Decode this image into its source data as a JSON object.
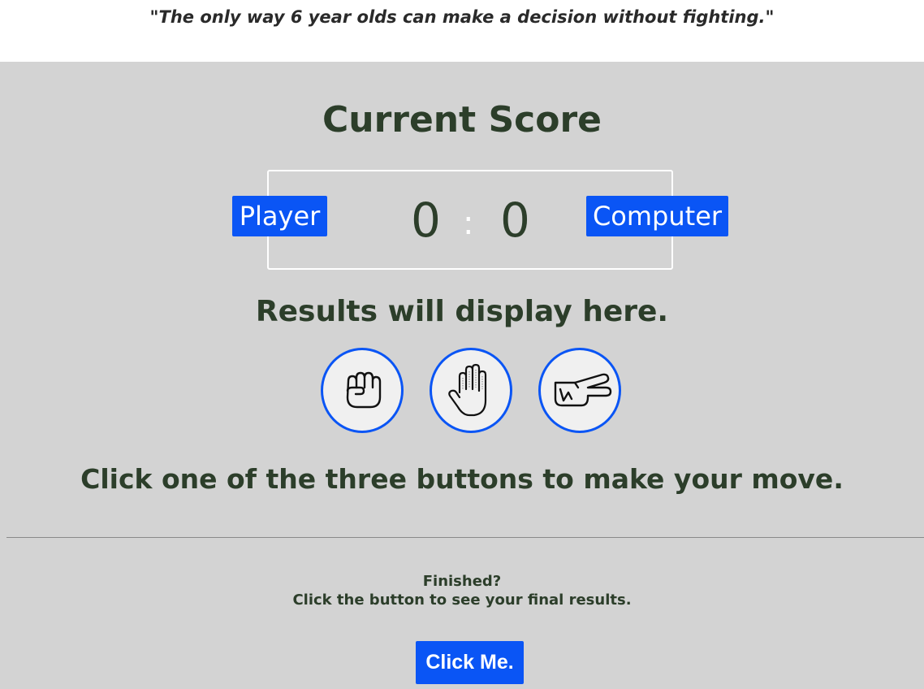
{
  "header": {
    "quote": "\"The only way 6 year olds can make a decision without fighting.\""
  },
  "scoreboard": {
    "title": "Current Score",
    "player_label": "Player",
    "computer_label": "Computer",
    "player_score": "0",
    "separator": ":",
    "computer_score": "0"
  },
  "results": {
    "text": "Results will display here."
  },
  "moves": [
    {
      "name": "rock",
      "icon": "fist-icon"
    },
    {
      "name": "paper",
      "icon": "open-hand-icon"
    },
    {
      "name": "scissors",
      "icon": "peace-hand-icon"
    }
  ],
  "instructions": {
    "text": "Click one of the three buttons to make your move."
  },
  "footer": {
    "finished_line1": "Finished?",
    "finished_line2": "Click the button to see your final results.",
    "button_label": "Click Me."
  },
  "colors": {
    "accent": "#0a55f5",
    "background": "#d3d3d3",
    "text": "#2c3e2a"
  }
}
